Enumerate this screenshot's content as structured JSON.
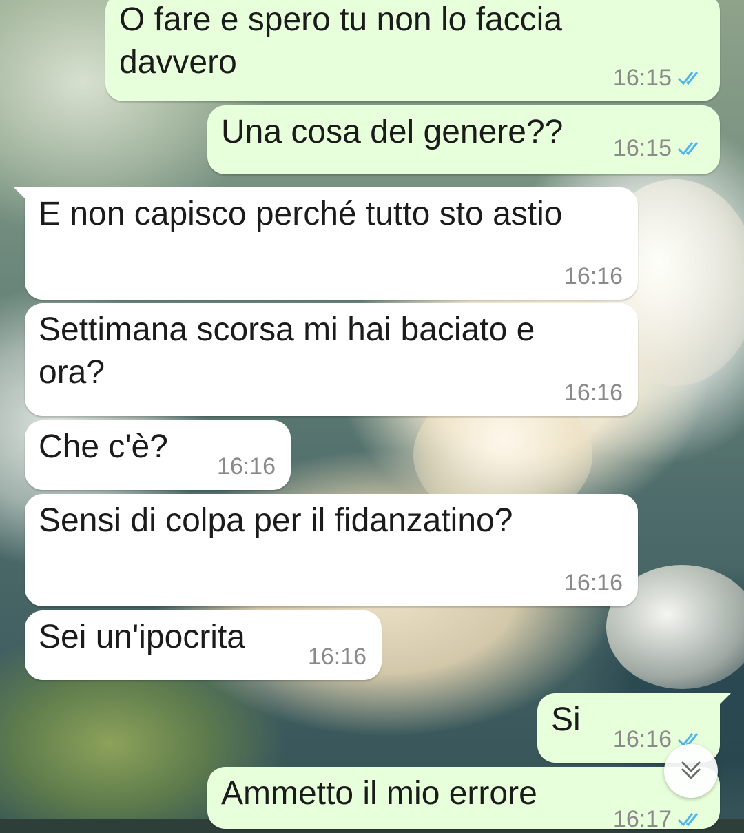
{
  "theme": {
    "outgoing_bubble_color": "#e7ffdb",
    "incoming_bubble_color": "#ffffff",
    "read_tick_color": "#4fb6ec",
    "timestamp_color": "#8a8a8a"
  },
  "messages": [
    {
      "direction": "out",
      "text": "O fare e spero tu non lo faccia davvero",
      "time": "16:15",
      "status": "read"
    },
    {
      "direction": "out",
      "text": "Una cosa del genere??",
      "time": "16:15",
      "status": "read"
    },
    {
      "direction": "in",
      "text": "E non capisco perché tutto sto astio",
      "time": "16:16"
    },
    {
      "direction": "in",
      "text": "Settimana scorsa mi hai baciato e ora?",
      "time": "16:16"
    },
    {
      "direction": "in",
      "text": "Che c'è?",
      "time": "16:16"
    },
    {
      "direction": "in",
      "text": "Sensi di colpa per il fidanzatino?",
      "time": "16:16"
    },
    {
      "direction": "in",
      "text": "Sei un'ipocrita",
      "time": "16:16"
    },
    {
      "direction": "out",
      "text": "Si",
      "time": "16:16",
      "status": "read"
    },
    {
      "direction": "out",
      "text": "Ammetto il mio errore",
      "time": "16:17",
      "status": "read"
    }
  ],
  "scroll_button": {
    "icon": "double-chevron-down-icon"
  }
}
